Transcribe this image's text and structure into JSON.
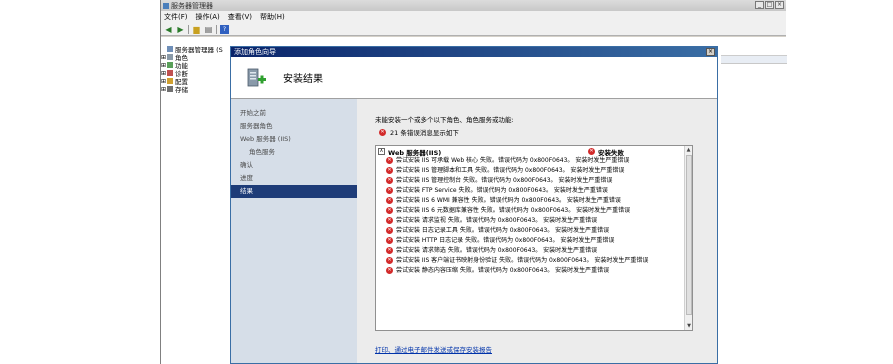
{
  "window": {
    "title": "服务器管理器",
    "menus": [
      "文件(F)",
      "操作(A)",
      "查看(V)",
      "帮助(H)"
    ],
    "controls": [
      "_",
      "□",
      "×"
    ]
  },
  "tree": {
    "items": [
      {
        "label": "服务器管理器 (S",
        "expand": ""
      },
      {
        "label": "角色",
        "expand": "⊞"
      },
      {
        "label": "功能",
        "expand": "⊞"
      },
      {
        "label": "诊断",
        "expand": "⊞"
      },
      {
        "label": "配置",
        "expand": "⊞"
      },
      {
        "label": "存储",
        "expand": "⊞"
      }
    ]
  },
  "wizard": {
    "title": "添加角色向导",
    "close": "×",
    "header_title": "安装结果",
    "nav": [
      {
        "label": "开始之前",
        "sub": false,
        "active": false
      },
      {
        "label": "服务器角色",
        "sub": false,
        "active": false
      },
      {
        "label": "Web 服务器 (IIS)",
        "sub": false,
        "active": false
      },
      {
        "label": "角色服务",
        "sub": true,
        "active": false
      },
      {
        "label": "确认",
        "sub": false,
        "active": false
      },
      {
        "label": "进度",
        "sub": false,
        "active": false
      },
      {
        "label": "结果",
        "sub": false,
        "active": true
      }
    ],
    "intro": "未能安装一个或多个以下角色、角色服务或功能:",
    "error_summary": "21 条错误消息显示如下",
    "results": {
      "role": "Web 服务器(IIS)",
      "status": "安装失败",
      "collapse": "∧",
      "rows": [
        "尝试安装 IIS 可承载 Web 核心 失败。错误代码为 0x800F0643。 安装时发生严重错误",
        "尝试安装 IIS 管理脚本和工具 失败。错误代码为 0x800F0643。 安装时发生严重错误",
        "尝试安装 IIS 管理控制台 失败。错误代码为 0x800F0643。 安装时发生严重错误",
        "尝试安装 FTP Service 失败。错误代码为 0x800F0643。 安装时发生严重错误",
        "尝试安装 IIS 6 WMI 兼容性 失败。错误代码为 0x800F0643。 安装时发生严重错误",
        "尝试安装 IIS 6 元数据库兼容性 失败。错误代码为 0x800F0643。 安装时发生严重错误",
        "尝试安装 请求监视 失败。错误代码为 0x800F0643。 安装时发生严重错误",
        "尝试安装 日志记录工具 失败。错误代码为 0x800F0643。 安装时发生严重错误",
        "尝试安装 HTTP 日志记录 失败。错误代码为 0x800F0643。 安装时发生严重错误",
        "尝试安装 请求筛选 失败。错误代码为 0x800F0643。 安装时发生严重错误",
        "尝试安装 IIS 客户端证书映射身份验证 失败。错误代码为 0x800F0643。 安装时发生严重错误",
        "尝试安装 静态内容压缩 失败。错误代码为 0x800F0643。 安装时发生严重错误"
      ]
    },
    "print_link": "打印、通过电子邮件发送或保存安装报告"
  },
  "colors": {
    "nav_active": "#1e3c78",
    "error": "#d22a2a",
    "link": "#0033aa"
  }
}
